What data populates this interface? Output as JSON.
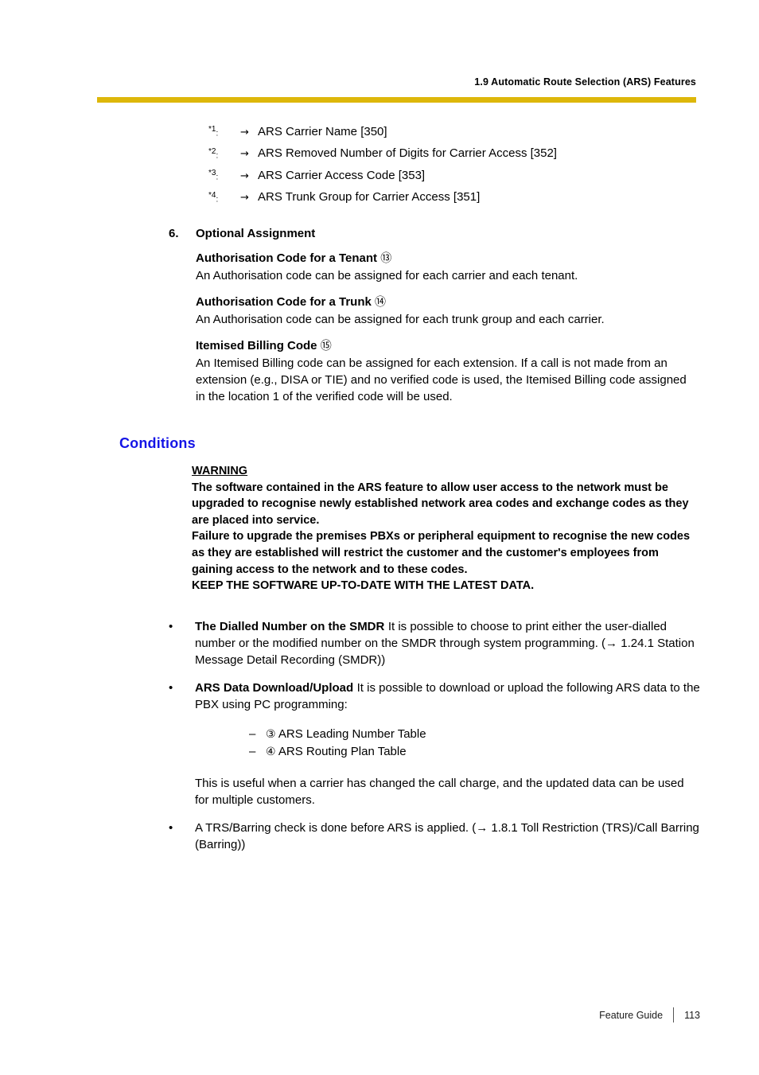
{
  "header": {
    "section_title": "1.9 Automatic Route Selection (ARS) Features",
    "rule_color": "#ddb70a"
  },
  "footnotes": [
    {
      "mark": "*1",
      "arrow": "→",
      "text": "ARS Carrier Name [350]"
    },
    {
      "mark": "*2",
      "arrow": "→",
      "text": "ARS Removed Number of Digits for Carrier Access [352]"
    },
    {
      "mark": "*3",
      "arrow": "→",
      "text": "ARS Carrier Access Code [353]"
    },
    {
      "mark": "*4",
      "arrow": "→",
      "text": "ARS Trunk Group for Carrier Access [351]"
    }
  ],
  "optional_assignment": {
    "number": "6.",
    "title": "Optional Assignment",
    "items": [
      {
        "heading": "Authorisation Code for a Tenant",
        "circled": "⑬",
        "body": "An Authorisation code can be assigned for each carrier and each tenant."
      },
      {
        "heading": "Authorisation Code for a Trunk",
        "circled": "⑭",
        "body": "An Authorisation code can be assigned for each trunk group and each carrier."
      },
      {
        "heading": "Itemised Billing Code",
        "circled": "⑮",
        "body": "An Itemised Billing code can be assigned for each extension.\nIf a call is not made from an extension (e.g., DISA or TIE) and no verified code is used, the Itemised Billing code assigned in the location 1 of the verified code will be used."
      }
    ]
  },
  "conditions": {
    "heading": "Conditions",
    "heading_color": "#1414e6",
    "warning": {
      "label": "WARNING",
      "paragraphs": [
        "The software contained in the ARS feature to allow user access to the network must be upgraded to recognise newly established network area codes and exchange codes as they are placed into service.",
        "Failure to upgrade the premises PBXs or peripheral equipment to recognise the new codes as they are established will restrict the customer and the customer's employees from gaining access to the network and to these codes.",
        "KEEP THE SOFTWARE UP-TO-DATE WITH THE LATEST DATA."
      ]
    },
    "bullets": [
      {
        "marker": "•",
        "title": "The Dialled Number on the SMDR",
        "text": "It is possible to choose to print either the user-dialled number or the modified number on the SMDR through system programming. (→ 1.24.1 Station Message Detail Recording (SMDR))"
      },
      {
        "marker": "•",
        "title": "ARS Data Download/Upload",
        "text": "It is possible to download or upload the following ARS data to the PBX using PC programming:"
      }
    ],
    "dash_items": [
      {
        "mark": "–",
        "circled": "③",
        "text": "ARS Leading Number Table"
      },
      {
        "mark": "–",
        "circled": "④",
        "text": "ARS Routing Plan Table"
      }
    ],
    "trailing_paragraph": "This is useful when a carrier has changed the call charge, and the updated data can be used for multiple customers.",
    "final_bullet": {
      "marker": "•",
      "text": "A TRS/Barring check is done before ARS is applied. (→ 1.8.1 Toll Restriction (TRS)/Call Barring (Barring))"
    }
  },
  "footer": {
    "guide_label": "Feature Guide",
    "page_number": "113"
  }
}
